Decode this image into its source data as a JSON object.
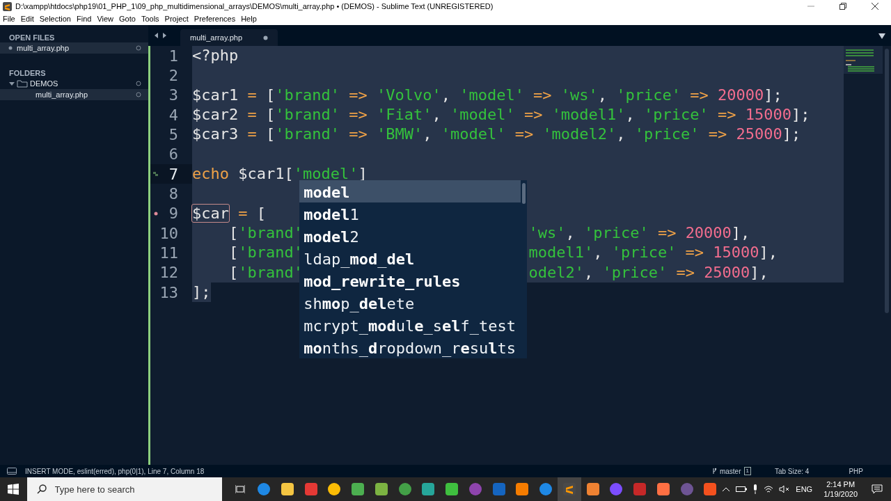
{
  "window": {
    "title": "D:\\xampp\\htdocs\\php19\\01_PHP_1\\09_php_multidimensional_arrays\\DEMOS\\multi_array.php • (DEMOS) - Sublime Text (UNREGISTERED)"
  },
  "menu": [
    "File",
    "Edit",
    "Selection",
    "Find",
    "View",
    "Goto",
    "Tools",
    "Project",
    "Preferences",
    "Help"
  ],
  "sidebar": {
    "open_files_title": "OPEN FILES",
    "open_files": [
      {
        "name": "multi_array.php",
        "selected": true
      }
    ],
    "folders_title": "FOLDERS",
    "folders": [
      {
        "name": "DEMOS",
        "expanded": true,
        "selected": false,
        "children": [
          {
            "name": "multi_array.php",
            "selected": true
          }
        ]
      }
    ]
  },
  "tabs": [
    {
      "label": "multi_array.php",
      "selected": true,
      "modified": true
    }
  ],
  "editor": {
    "lines": [
      {
        "number": "1",
        "selected": true,
        "tokens": [
          {
            "kind": "tag",
            "text": "<?php"
          }
        ]
      },
      {
        "number": "2",
        "selected": true
      },
      {
        "number": "3",
        "selected": true,
        "tokens": [
          {
            "kind": "var",
            "text": "$car1"
          },
          {
            "kind": "op",
            "text": " = "
          },
          {
            "kind": "punct",
            "text": "["
          },
          {
            "kind": "str",
            "text": "'brand'"
          },
          {
            "kind": "op",
            "text": " => "
          },
          {
            "kind": "str",
            "text": "'Volvo'"
          },
          {
            "kind": "punct",
            "text": ", "
          },
          {
            "kind": "str",
            "text": "'model'"
          },
          {
            "kind": "op",
            "text": " => "
          },
          {
            "kind": "str",
            "text": "'ws'"
          },
          {
            "kind": "punct",
            "text": ", "
          },
          {
            "kind": "str",
            "text": "'price'"
          },
          {
            "kind": "op",
            "text": " => "
          },
          {
            "kind": "num",
            "text": "20000"
          },
          {
            "kind": "punct",
            "text": "];"
          }
        ]
      },
      {
        "number": "4",
        "selected": true,
        "tokens": [
          {
            "kind": "var",
            "text": "$car2"
          },
          {
            "kind": "op",
            "text": " = "
          },
          {
            "kind": "punct",
            "text": "["
          },
          {
            "kind": "str",
            "text": "'brand'"
          },
          {
            "kind": "op",
            "text": " => "
          },
          {
            "kind": "str",
            "text": "'Fiat'"
          },
          {
            "kind": "punct",
            "text": ", "
          },
          {
            "kind": "str",
            "text": "'model'"
          },
          {
            "kind": "op",
            "text": " => "
          },
          {
            "kind": "str",
            "text": "'model1'"
          },
          {
            "kind": "punct",
            "text": ", "
          },
          {
            "kind": "str",
            "text": "'price'"
          },
          {
            "kind": "op",
            "text": " => "
          },
          {
            "kind": "num",
            "text": "15000"
          },
          {
            "kind": "punct",
            "text": "];"
          }
        ]
      },
      {
        "number": "5",
        "selected": true,
        "tokens": [
          {
            "kind": "var",
            "text": "$car3"
          },
          {
            "kind": "op",
            "text": " = "
          },
          {
            "kind": "punct",
            "text": "["
          },
          {
            "kind": "str",
            "text": "'brand'"
          },
          {
            "kind": "op",
            "text": " => "
          },
          {
            "kind": "str",
            "text": "'BMW'"
          },
          {
            "kind": "punct",
            "text": ", "
          },
          {
            "kind": "str",
            "text": "'model'"
          },
          {
            "kind": "op",
            "text": " => "
          },
          {
            "kind": "str",
            "text": "'model2'"
          },
          {
            "kind": "punct",
            "text": ", "
          },
          {
            "kind": "str",
            "text": "'price'"
          },
          {
            "kind": "op",
            "text": " => "
          },
          {
            "kind": "num",
            "text": "25000"
          },
          {
            "kind": "punct",
            "text": "];"
          }
        ]
      },
      {
        "number": "6",
        "selected": true
      },
      {
        "number": "7",
        "bracket_marker": true,
        "current": true,
        "selected": true,
        "tokens": [
          {
            "kind": "kw",
            "text": "echo"
          },
          {
            "kind": "var",
            "text": " $car1"
          },
          {
            "kind": "punct",
            "text": "["
          },
          {
            "kind": "str",
            "text": "'model'"
          },
          {
            "kind": "punct",
            "text": "]"
          }
        ]
      },
      {
        "number": "8",
        "selected": true
      },
      {
        "number": "9",
        "lint_error": true,
        "selected": true,
        "tokens": [
          {
            "kind": "var",
            "text": "$car",
            "outlined": true
          },
          {
            "kind": "op",
            "text": " = "
          },
          {
            "kind": "punct",
            "text": "["
          }
        ]
      },
      {
        "number": "10",
        "selected": true,
        "tokens": [
          {
            "kind": "punct",
            "text": "    ["
          },
          {
            "kind": "str",
            "text": "'brand'"
          }
        ],
        "after_popup": [
          {
            "kind": "str",
            "text": "'ws'"
          },
          {
            "kind": "punct",
            "text": ", "
          },
          {
            "kind": "str",
            "text": "'price'"
          },
          {
            "kind": "op",
            "text": " => "
          },
          {
            "kind": "num",
            "text": "20000"
          },
          {
            "kind": "punct",
            "text": "],"
          }
        ]
      },
      {
        "number": "11",
        "selected": true,
        "tokens": [
          {
            "kind": "punct",
            "text": "    ["
          },
          {
            "kind": "str",
            "text": "'brand'"
          }
        ],
        "after_popup": [
          {
            "kind": "str",
            "text": "model1'"
          },
          {
            "kind": "punct",
            "text": ", "
          },
          {
            "kind": "str",
            "text": "'price'"
          },
          {
            "kind": "op",
            "text": " => "
          },
          {
            "kind": "num",
            "text": "15000"
          },
          {
            "kind": "punct",
            "text": "],"
          }
        ]
      },
      {
        "number": "12",
        "selected": true,
        "tokens": [
          {
            "kind": "punct",
            "text": "    ["
          },
          {
            "kind": "str",
            "text": "'brand'"
          }
        ],
        "after_popup": [
          {
            "kind": "str",
            "text": "odel2'"
          },
          {
            "kind": "punct",
            "text": ", "
          },
          {
            "kind": "str",
            "text": "'price'"
          },
          {
            "kind": "op",
            "text": " => "
          },
          {
            "kind": "num",
            "text": "25000"
          },
          {
            "kind": "punct",
            "text": "],"
          }
        ]
      },
      {
        "number": "13",
        "selected": true,
        "tokens": [
          {
            "kind": "punct",
            "text": "];"
          }
        ]
      }
    ]
  },
  "autocomplete": [
    {
      "text": "**model**",
      "selected": true
    },
    {
      "text": "**model**1",
      "selected": false
    },
    {
      "text": "**model**2",
      "selected": false
    },
    {
      "text": "ldap_**mod**_**del**",
      "selected": false
    },
    {
      "text": "**mod_rewrite_rules**",
      "selected": false
    },
    {
      "text": "sh**mo**p_**del**ete",
      "selected": false
    },
    {
      "text": "mcrypt_**mod**ul**e**_s**el**f_test",
      "selected": false
    },
    {
      "text": "**mo**nths_**d**ropdown_r**e**su**l**ts",
      "selected": false
    }
  ],
  "status_bar": {
    "text": "INSERT MODE, eslint(erred), php(0|1), Line 7, Column 18",
    "branch": "master",
    "branch_badge": "1",
    "tab_size": "Tab Size: 4",
    "syntax": "PHP"
  },
  "taskbar": {
    "search": {
      "placeholder": "Type here to search"
    },
    "language": "ENG",
    "time": "2:14 PM",
    "date": "1/19/2020"
  }
}
